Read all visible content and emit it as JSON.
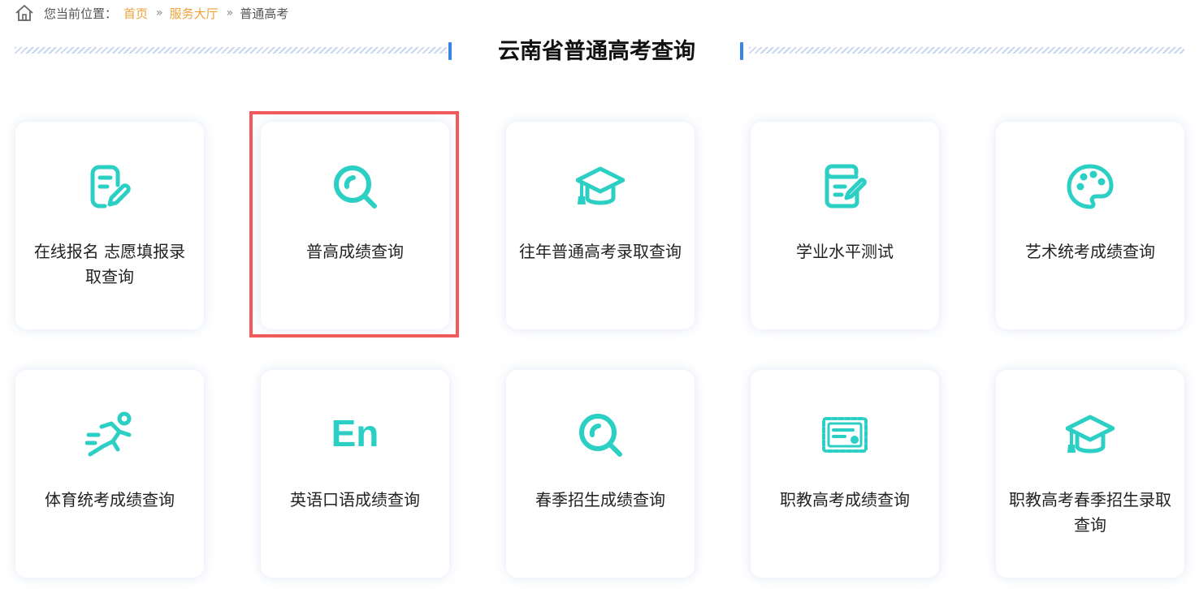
{
  "breadcrumb": {
    "prefix": "您当前位置：",
    "items": [
      "首页",
      "服务大厅",
      "普通高考"
    ],
    "separator": "»"
  },
  "page_title": "云南省普通高考查询",
  "accent_color": "#2ccfc3",
  "highlight_color": "#f05a5a",
  "cards": [
    {
      "label": "在线报名 志愿填报录取查询",
      "icon": "edit-document-icon"
    },
    {
      "label": "普高成绩查询",
      "icon": "search-icon"
    },
    {
      "label": "往年普通高考录取查询",
      "icon": "graduation-cap-icon"
    },
    {
      "label": "学业水平测试",
      "icon": "scroll-document-icon"
    },
    {
      "label": "艺术统考成绩查询",
      "icon": "palette-icon"
    },
    {
      "label": "体育统考成绩查询",
      "icon": "runner-icon"
    },
    {
      "label": "英语口语成绩查询",
      "icon": "english-en-icon"
    },
    {
      "label": "春季招生成绩查询",
      "icon": "search-icon"
    },
    {
      "label": "职教高考成绩查询",
      "icon": "certificate-icon"
    },
    {
      "label": "职教高考春季招生录取查询",
      "icon": "graduation-cap-icon"
    }
  ]
}
